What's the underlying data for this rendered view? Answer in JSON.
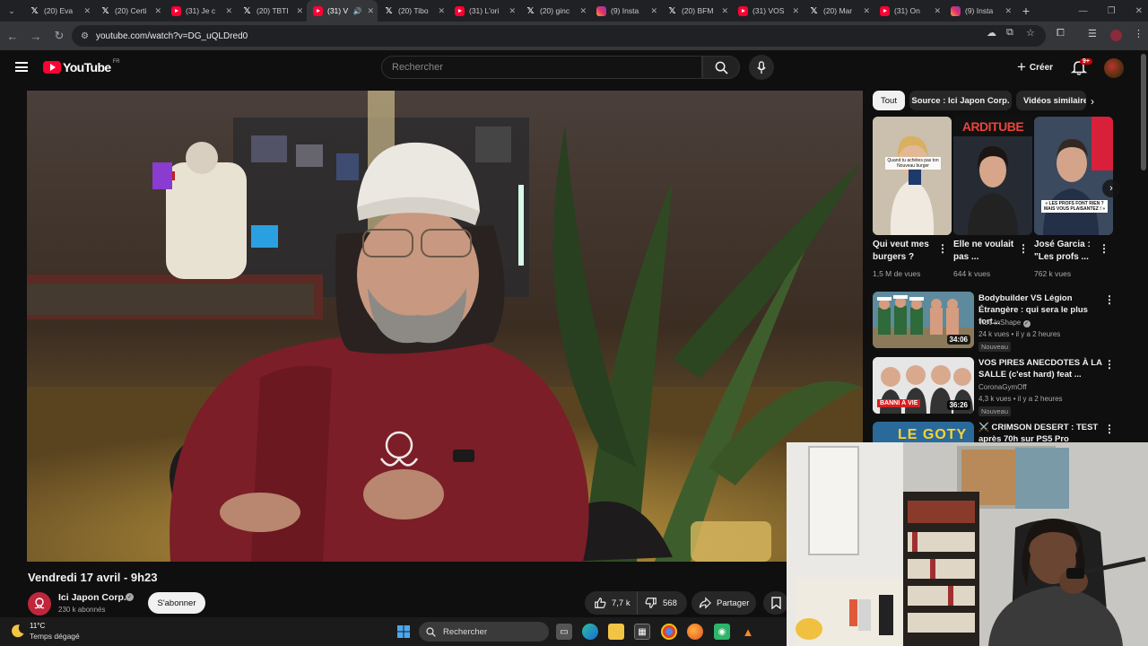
{
  "browser": {
    "tabs": [
      {
        "icon": "x",
        "label": "(20) Eva"
      },
      {
        "icon": "x",
        "label": "(20) Certi"
      },
      {
        "icon": "yt",
        "label": "(31) Je c"
      },
      {
        "icon": "x",
        "label": "(20) TBTI"
      },
      {
        "icon": "yt",
        "label": "(31) V",
        "active": true,
        "audio": true
      },
      {
        "icon": "x",
        "label": "(20) Tibo"
      },
      {
        "icon": "yt",
        "label": "(31) L'ori"
      },
      {
        "icon": "x",
        "label": "(20) ginc"
      },
      {
        "icon": "ig",
        "label": "(9) Insta"
      },
      {
        "icon": "x",
        "label": "(20) BFM"
      },
      {
        "icon": "yt",
        "label": "(31) VOS"
      },
      {
        "icon": "x",
        "label": "(20) Mar"
      },
      {
        "icon": "yt",
        "label": "(31) On"
      },
      {
        "icon": "ig",
        "label": "(9) Insta"
      }
    ],
    "url": "youtube.com/watch?v=DG_uQLDred0"
  },
  "youtube": {
    "logo_text": "YouTube",
    "country": "FR",
    "search_placeholder": "Rechercher",
    "create_label": "Créer",
    "notifications_badge": "9+"
  },
  "video": {
    "title": "Vendredi 17 avril - 9h23",
    "channel": "Ici Japon Corp.",
    "subscribers": "230 k abonnés",
    "subscribe_label": "S'abonner",
    "likes": "7,7 k",
    "dislikes": "568",
    "share_label": "Partager"
  },
  "sidebar": {
    "chips": [
      "Tout",
      "Source : Ici Japon Corp.",
      "Vidéos similaires"
    ],
    "shorts": [
      {
        "title": "Qui veut mes burgers ?",
        "views": "1,5 M de vues",
        "overlay": "Quand tu achètes pas ton Nouveau burger"
      },
      {
        "title": "Elle ne voulait pas ...",
        "views": "644 k vues",
        "overlay": "ARDITUBE"
      },
      {
        "title": "José Garcia : \"Les profs ...",
        "views": "762 k vues",
        "overlay": "« LES PROFS FONT RIEN ? MAIS VOUS PLAISANTEZ ! »"
      }
    ],
    "related": [
      {
        "title": "Bodybuilder VS Légion Étrangère : qui sera le plus fort...",
        "channel": "Tibo InShape",
        "meta": "24 k vues • il y a 2 heures",
        "duration": "34:06",
        "badge": "Nouveau"
      },
      {
        "title": "VOS PIRES ANECDOTES À LA SALLE (c'est hard) feat ...",
        "channel": "CoronaGymOff",
        "meta": "4,3 k vues • il y a 2 heures",
        "duration": "36:26",
        "badge": "Nouveau",
        "thumb_tag": "BANNI À VIE"
      },
      {
        "title": "⚔️ CRIMSON DESERT : TEST après 70h sur PS5 Pro (histoir...",
        "thumb_tag": "LE GOTY ?"
      }
    ]
  },
  "taskbar": {
    "temp": "11°C",
    "weather": "Temps dégagé",
    "search_label": "Rechercher"
  }
}
